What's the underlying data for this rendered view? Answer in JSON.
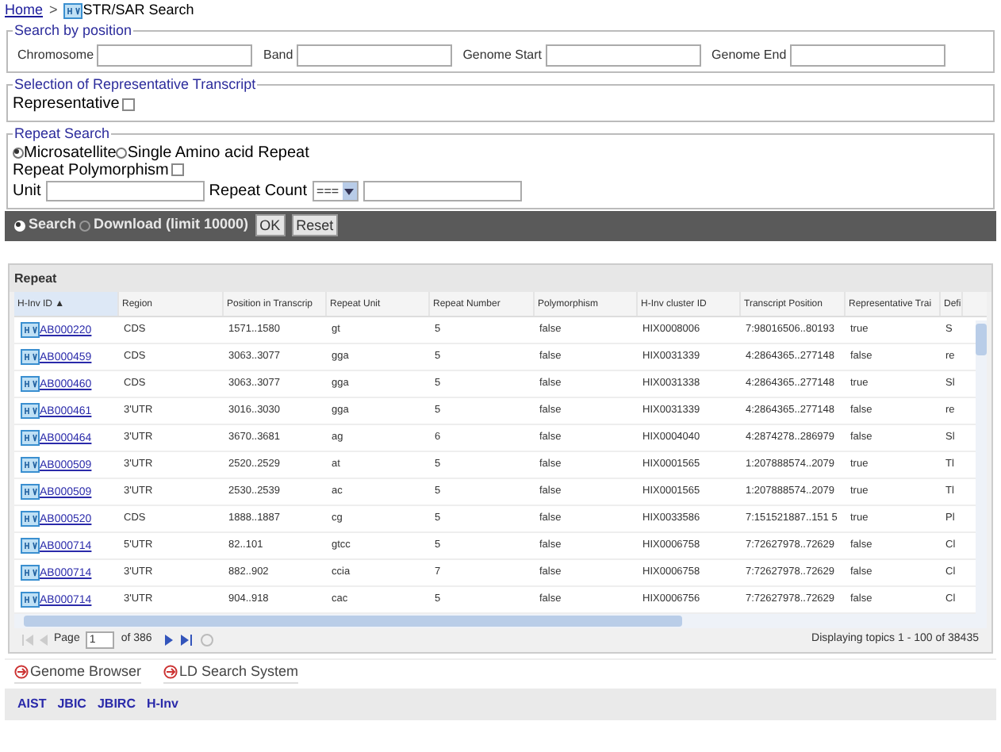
{
  "breadcrumb": {
    "home": "Home",
    "separator": ">",
    "current": "STR/SAR Search"
  },
  "search_by_position": {
    "legend": "Search by position",
    "fields": [
      {
        "label": "Chromosome"
      },
      {
        "label": "Band"
      },
      {
        "label": "Genome Start"
      },
      {
        "label": "Genome End"
      }
    ]
  },
  "representative_transcript": {
    "legend": "Selection of Representative Transcript",
    "label": "Representative",
    "checked": false
  },
  "repeat_search": {
    "legend": "Repeat Search",
    "types": [
      {
        "label": "Microsatellite",
        "selected": true
      },
      {
        "label": "Single Amino acid Repeat",
        "selected": false
      }
    ],
    "polymorphism": {
      "label": "Repeat Polymorphism",
      "checked": false
    },
    "unit_label": "Unit",
    "count_label": "Repeat Count",
    "count_operator": "==="
  },
  "toolbar": {
    "modes": [
      {
        "label": "Search",
        "selected": true
      },
      {
        "label": "Download (limit 10000)",
        "selected": false
      }
    ],
    "buttons": [
      "OK",
      "Reset"
    ]
  },
  "grid": {
    "title": "Repeat",
    "columns": [
      "H-Inv ID ▲",
      "Region",
      "Position in Transcrip",
      "Repeat Unit",
      "Repeat Number",
      "Polymorphism",
      "H-Inv cluster ID",
      "Transcript Position",
      "Representative Trai",
      "Defi"
    ],
    "rows": [
      [
        "AB000220",
        "CDS",
        "1571..1580",
        "gt",
        "5",
        "false",
        "HIX0008006",
        "7:98016506..80193",
        "true",
        "S"
      ],
      [
        "AB000459",
        "CDS",
        "3063..3077",
        "gga",
        "5",
        "false",
        "HIX0031339",
        "4:2864365..277148",
        "false",
        "re"
      ],
      [
        "AB000460",
        "CDS",
        "3063..3077",
        "gga",
        "5",
        "false",
        "HIX0031338",
        "4:2864365..277148",
        "true",
        "Sl"
      ],
      [
        "AB000461",
        "3'UTR",
        "3016..3030",
        "gga",
        "5",
        "false",
        "HIX0031339",
        "4:2864365..277148",
        "false",
        "re"
      ],
      [
        "AB000464",
        "3'UTR",
        "3670..3681",
        "ag",
        "6",
        "false",
        "HIX0004040",
        "4:2874278..286979",
        "false",
        "Sl"
      ],
      [
        "AB000509",
        "3'UTR",
        "2520..2529",
        "at",
        "5",
        "false",
        "HIX0001565",
        "1:207888574..2079",
        "true",
        "Tl"
      ],
      [
        "AB000509",
        "3'UTR",
        "2530..2539",
        "ac",
        "5",
        "false",
        "HIX0001565",
        "1:207888574..2079",
        "true",
        "Tl"
      ],
      [
        "AB000520",
        "CDS",
        "1888..1887",
        "cg",
        "5",
        "false",
        "HIX0033586",
        "7:151521887..151 5",
        "true",
        "Pl"
      ],
      [
        "AB000714",
        "5'UTR",
        "82..101",
        "gtcc",
        "5",
        "false",
        "HIX0006758",
        "7:72627978..72629",
        "false",
        "Cl"
      ],
      [
        "AB000714",
        "3'UTR",
        "882..902",
        "ccia",
        "7",
        "false",
        "HIX0006758",
        "7:72627978..72629",
        "false",
        "Cl"
      ],
      [
        "AB000714",
        "3'UTR",
        "904..918",
        "cac",
        "5",
        "false",
        "HIX0006756",
        "7:72627978..72629",
        "false",
        "Cl"
      ]
    ],
    "pager": {
      "page_label": "Page",
      "page": "1",
      "of": "of 386",
      "display": "Displaying topics 1 - 100 of 38435"
    }
  },
  "links": [
    "Genome Browser",
    "LD Search System"
  ],
  "footer_links": [
    "AIST",
    "JBIC",
    "JBIRC",
    "H-Inv"
  ]
}
